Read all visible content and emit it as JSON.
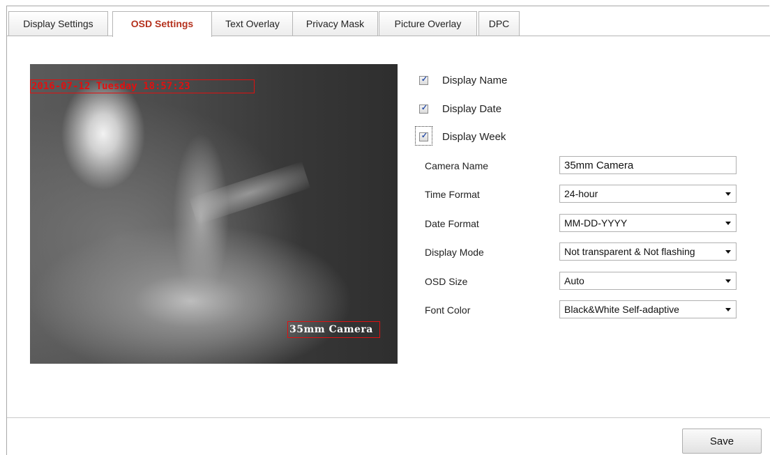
{
  "tabs": [
    {
      "label": "Display Settings",
      "active": false
    },
    {
      "label": "OSD Settings",
      "active": true
    },
    {
      "label": "Text Overlay",
      "active": false
    },
    {
      "label": "Privacy Mask",
      "active": false
    },
    {
      "label": "Picture Overlay",
      "active": false
    },
    {
      "label": "DPC",
      "active": false
    }
  ],
  "preview": {
    "date_overlay": "2016-07-12 Tuesday 18:57:23",
    "name_overlay": "35mm Camera",
    "overlay_color": "#e01010"
  },
  "checkboxes": {
    "display_name": {
      "label": "Display Name",
      "checked": true
    },
    "display_date": {
      "label": "Display Date",
      "checked": true
    },
    "display_week": {
      "label": "Display Week",
      "checked": true
    }
  },
  "fields": {
    "camera_name": {
      "label": "Camera Name",
      "value": "35mm Camera"
    },
    "time_format": {
      "label": "Time Format",
      "value": "24-hour"
    },
    "date_format": {
      "label": "Date Format",
      "value": "MM-DD-YYYY"
    },
    "display_mode": {
      "label": "Display Mode",
      "value": "Not transparent & Not flashing"
    },
    "osd_size": {
      "label": "OSD Size",
      "value": "Auto"
    },
    "font_color": {
      "label": "Font Color",
      "value": "Black&White Self-adaptive"
    }
  },
  "save_label": "Save",
  "accent_color": "#b5321e"
}
